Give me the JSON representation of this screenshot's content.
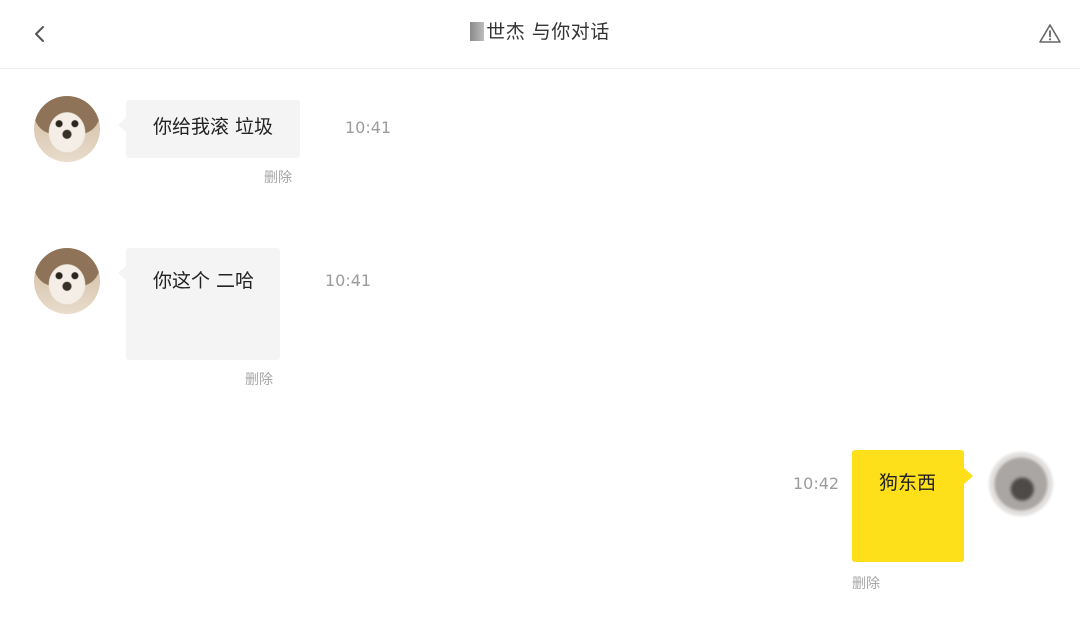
{
  "header": {
    "title": "世杰 与你对话",
    "back_icon": "chevron-left-icon",
    "report_icon": "warning-triangle-icon"
  },
  "messages": [
    {
      "direction": "incoming",
      "text": "你给我滚 垃圾",
      "time": "10:41",
      "delete_label": "删除"
    },
    {
      "direction": "incoming",
      "text": "你这个 二哈",
      "time": "10:41",
      "delete_label": "删除"
    },
    {
      "direction": "outgoing",
      "text": "狗东西",
      "time": "10:42",
      "delete_label": "删除"
    }
  ],
  "colors": {
    "outgoing_bubble": "#fde01a",
    "incoming_bubble": "#f4f4f4",
    "timestamp": "#9c9c9c",
    "divider": "#ececec"
  }
}
